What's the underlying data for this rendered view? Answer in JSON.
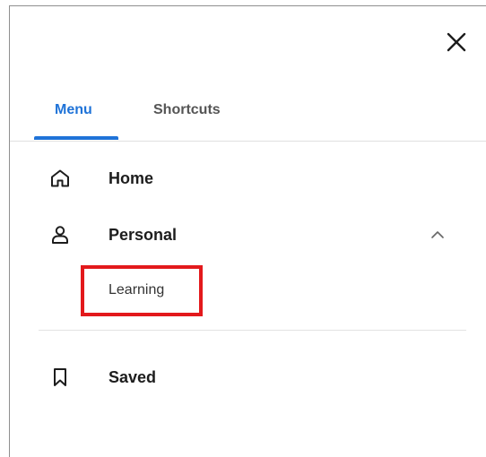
{
  "window": {
    "close_icon": "close-icon"
  },
  "tabs": [
    {
      "label": "Menu",
      "active": true
    },
    {
      "label": "Shortcuts",
      "active": false
    }
  ],
  "nav": {
    "home": {
      "label": "Home",
      "icon": "home-icon"
    },
    "personal": {
      "label": "Personal",
      "icon": "person-icon",
      "expanded": true,
      "children": [
        {
          "label": "Learning"
        }
      ]
    },
    "saved": {
      "label": "Saved",
      "icon": "bookmark-icon"
    }
  },
  "colors": {
    "accent": "#1f73d8",
    "highlight": "#e3191c",
    "text": "#1d1d1d",
    "muted_tab": "#555555"
  }
}
